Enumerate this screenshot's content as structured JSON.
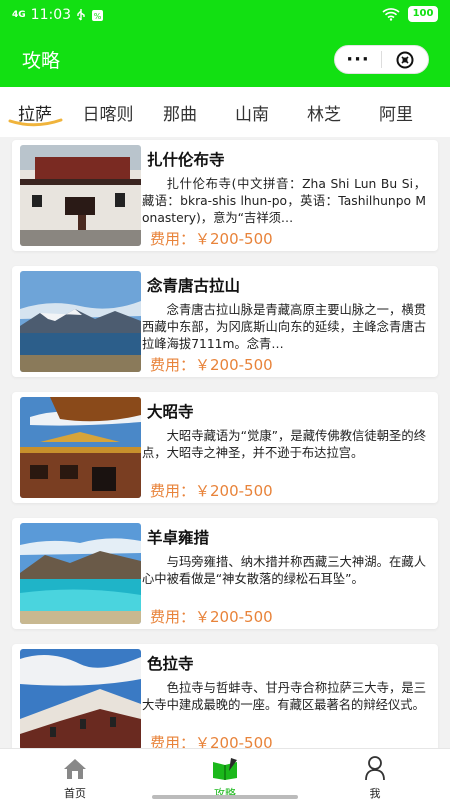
{
  "status_bar": {
    "signal": "4G",
    "time": "11:03",
    "battery": "100"
  },
  "nav": {
    "title": "攻略",
    "more": "···"
  },
  "tabs": [
    {
      "label": "拉萨",
      "active": true
    },
    {
      "label": "日喀则",
      "active": false
    },
    {
      "label": "那曲",
      "active": false
    },
    {
      "label": "山南",
      "active": false
    },
    {
      "label": "林芝",
      "active": false
    },
    {
      "label": "阿里",
      "active": false
    }
  ],
  "cards": [
    {
      "title": "扎什伦布寺",
      "desc": "扎什伦布寺(中文拼音：Zha Shi Lun Bu Si，藏语：bkra-shis lhun-po，英语：Tashilhunpo Monastery)，意为“吉祥须…",
      "price": "费用：￥200-500",
      "image": "monastery-photo"
    },
    {
      "title": "念青唐古拉山",
      "desc": "念青唐古拉山脉是青藏高原主要山脉之一，横贯西藏中东部，为冈底斯山向东的延续，主峰念青唐古拉峰海拔7111m。念青…",
      "price": "费用：￥200-500",
      "image": "mountain-lake-photo"
    },
    {
      "title": "大昭寺",
      "desc": "大昭寺藏语为“觉康”，是藏传佛教信徒朝圣的终点，大昭寺之神圣，并不逊于布达拉宫。",
      "price": "费用：￥200-500",
      "image": "temple-roof-photo"
    },
    {
      "title": "羊卓雍措",
      "desc": "与玛旁雍措、纳木措并称西藏三大神湖。在藏人心中被看做是“神女散落的绿松石耳坠”。",
      "price": "费用：￥200-500",
      "image": "turquoise-lake-photo"
    },
    {
      "title": "色拉寺",
      "desc": "色拉寺与哲蚌寺、甘丹寺合称拉萨三大寺，是三大寺中建成最晚的一座。有藏区最著名的辩经仪式。",
      "price": "费用：￥200-500",
      "image": "sera-monastery-photo"
    }
  ],
  "tabbar": [
    {
      "label": "首页",
      "icon": "home-icon",
      "active": false
    },
    {
      "label": "攻略",
      "icon": "book-icon",
      "active": true
    },
    {
      "label": "我",
      "icon": "person-icon",
      "active": false
    }
  ],
  "colors": {
    "brand_green": "#12e012",
    "price_orange": "#e8833a",
    "active_tab_green": "#1bb81b"
  }
}
